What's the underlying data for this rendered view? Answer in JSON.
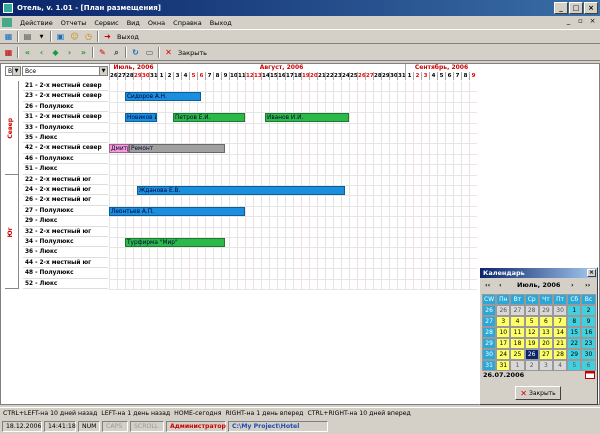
{
  "window": {
    "title": "Отель, v. 1.01 - [План размещения]"
  },
  "menu": [
    "Действие",
    "Отчеты",
    "Сервис",
    "Вид",
    "Окна",
    "Справка",
    "Выход"
  ],
  "toolbar1": {
    "exit_label": "Выход"
  },
  "toolbar2": {
    "close_label": "Закрыть"
  },
  "filter": {
    "building": "В",
    "scope": "Все"
  },
  "months": [
    {
      "label": "Июль, 2006",
      "start": 0,
      "span": 6
    },
    {
      "label": "Август, 2006",
      "start": 6,
      "span": 31
    },
    {
      "label": "Сентябрь, 2006",
      "start": 37,
      "span": 9
    }
  ],
  "days": [
    {
      "d": "26",
      "w": false
    },
    {
      "d": "27",
      "w": false
    },
    {
      "d": "28",
      "w": false
    },
    {
      "d": "29",
      "w": true
    },
    {
      "d": "30",
      "w": true
    },
    {
      "d": "31",
      "w": false
    },
    {
      "d": "1",
      "w": false
    },
    {
      "d": "2",
      "w": false
    },
    {
      "d": "3",
      "w": false
    },
    {
      "d": "4",
      "w": false
    },
    {
      "d": "5",
      "w": true
    },
    {
      "d": "6",
      "w": true
    },
    {
      "d": "7",
      "w": false
    },
    {
      "d": "8",
      "w": false
    },
    {
      "d": "9",
      "w": false
    },
    {
      "d": "10",
      "w": false
    },
    {
      "d": "11",
      "w": false
    },
    {
      "d": "12",
      "w": true
    },
    {
      "d": "13",
      "w": true
    },
    {
      "d": "14",
      "w": false
    },
    {
      "d": "15",
      "w": false
    },
    {
      "d": "16",
      "w": false
    },
    {
      "d": "17",
      "w": false
    },
    {
      "d": "18",
      "w": false
    },
    {
      "d": "19",
      "w": true
    },
    {
      "d": "20",
      "w": true
    },
    {
      "d": "21",
      "w": false
    },
    {
      "d": "22",
      "w": false
    },
    {
      "d": "23",
      "w": false
    },
    {
      "d": "24",
      "w": false
    },
    {
      "d": "25",
      "w": false
    },
    {
      "d": "26",
      "w": true
    },
    {
      "d": "27",
      "w": true
    },
    {
      "d": "28",
      "w": false
    },
    {
      "d": "29",
      "w": false
    },
    {
      "d": "30",
      "w": false
    },
    {
      "d": "31",
      "w": false
    },
    {
      "d": "1",
      "w": false
    },
    {
      "d": "2",
      "w": true
    },
    {
      "d": "3",
      "w": true
    },
    {
      "d": "4",
      "w": false
    },
    {
      "d": "5",
      "w": false
    },
    {
      "d": "6",
      "w": false
    },
    {
      "d": "7",
      "w": false
    },
    {
      "d": "8",
      "w": false
    },
    {
      "d": "9",
      "w": true
    }
  ],
  "groups": [
    {
      "label": "Север",
      "rows": [
        "21 - 2-х местный север",
        "23 - 2-х местный север",
        "26 - Полулюкс",
        "31 - 2-х местный север",
        "33 - Полулюкс",
        "35 - Люкс",
        "42 - 2-х местный север",
        "46 - Полулюкс",
        "51 - Люкс"
      ]
    },
    {
      "label": "Юг",
      "rows": [
        "22 - 2-х местный юг",
        "24 - 2-х местный юг",
        "26 - 2-х местный юг",
        "27 - Полулюкс",
        "29 - Люкс",
        "32 - 2-х местный юг",
        "34 - Полулюкс",
        "36 - Люкс",
        "44 - 2-х местный юг",
        "48 - Полулюкс",
        "52 - Люкс"
      ]
    }
  ],
  "bookings": [
    {
      "row": 1,
      "start": 4,
      "end": 23,
      "label": "Сидоров А.Н.",
      "color": "#1a8fe0"
    },
    {
      "row": 3,
      "start": 4,
      "end": 12,
      "label": "Новиков И.В.",
      "color": "#1a8fe0"
    },
    {
      "row": 3,
      "start": 16,
      "end": 34,
      "label": "Петров Е.И.",
      "color": "#2db84a"
    },
    {
      "row": 3,
      "start": 39,
      "end": 60,
      "label": "Иванов И.И.",
      "color": "#2db84a"
    },
    {
      "row": 6,
      "start": 0,
      "end": 5,
      "label": "Дмитрин И.",
      "color": "#f59ad6"
    },
    {
      "row": 6,
      "start": 5,
      "end": 29,
      "label": "Ремонт",
      "color": "#a0a0a0"
    },
    {
      "row": 10,
      "start": 7,
      "end": 59,
      "label": "Жданова Е.В.",
      "color": "#1a8fe0"
    },
    {
      "row": 12,
      "start": 0,
      "end": 34,
      "label": "Леонтьев А.П.",
      "color": "#1a8fe0"
    },
    {
      "row": 15,
      "start": 4,
      "end": 29,
      "label": "Турфирма \"Мир\"",
      "color": "#2db84a"
    }
  ],
  "calendar": {
    "title": "Календарь",
    "month_label": "Июль, 2006",
    "headers": [
      "CW",
      "Пн",
      "Вт",
      "Ср",
      "Чт",
      "Пт",
      "Сб",
      "Вс"
    ],
    "weeks": [
      [
        "26",
        "26",
        "27",
        "28",
        "29",
        "30",
        "1",
        "2"
      ],
      [
        "27",
        "3",
        "4",
        "5",
        "6",
        "7",
        "8",
        "9"
      ],
      [
        "28",
        "10",
        "11",
        "12",
        "13",
        "14",
        "15",
        "16"
      ],
      [
        "29",
        "17",
        "18",
        "19",
        "20",
        "21",
        "22",
        "23"
      ],
      [
        "30",
        "24",
        "25",
        "26",
        "27",
        "28",
        "29",
        "30"
      ],
      [
        "31",
        "31",
        "1",
        "2",
        "3",
        "4",
        "5",
        "6"
      ]
    ],
    "selected_date": "26.07.2006",
    "close_label": "Закрыть"
  },
  "hints": [
    "CTRL+LEFT-на 10 дней назад",
    "LEFT-на 1 день назад",
    "HOME-сегодня",
    "RIGHT-на 1 день вперед",
    "CTRL+RIGHT-на 10 дней вперед"
  ],
  "status": {
    "date": "18.12.2006",
    "time": "14:41:18",
    "num": "NUM",
    "caps": "CAPS",
    "scroll": "SCROLL",
    "user": "Администратор",
    "path": "C:\\My Project\\Hotel"
  }
}
